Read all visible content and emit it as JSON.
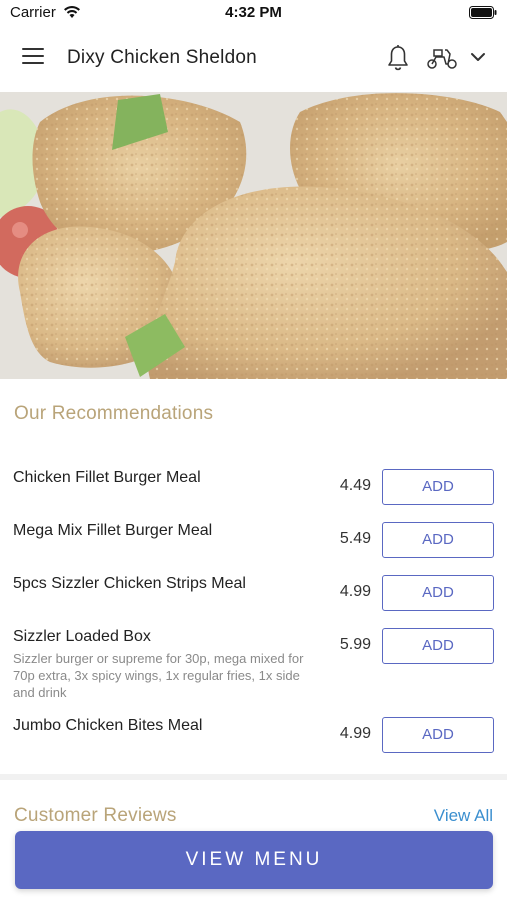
{
  "status_bar": {
    "carrier": "Carrier",
    "time": "4:32 PM",
    "icons": [
      "wifi-icon",
      "battery-icon"
    ]
  },
  "header": {
    "title": "Dixy Chicken Sheldon",
    "icons": [
      "menu-icon",
      "bell-icon",
      "scooter-icon",
      "chevron-down-icon"
    ]
  },
  "hero": {
    "image": "fried-chicken-photo"
  },
  "recommendations": {
    "title": "Our Recommendations",
    "items": [
      {
        "name": "Chicken Fillet Burger Meal",
        "description": "",
        "price": "4.49",
        "button": "ADD"
      },
      {
        "name": "Mega Mix Fillet Burger Meal",
        "description": "",
        "price": "5.49",
        "button": "ADD"
      },
      {
        "name": "5pcs Sizzler Chicken Strips Meal",
        "description": "",
        "price": "4.99",
        "button": "ADD"
      },
      {
        "name": "Sizzler Loaded Box",
        "description": "Sizzler burger or supreme for 30p, mega mixed for 70p extra, 3x spicy wings, 1x regular fries, 1x side and drink",
        "price": "5.99",
        "button": "ADD"
      },
      {
        "name": "Jumbo Chicken Bites Meal",
        "description": "",
        "price": "4.99",
        "button": "ADD"
      }
    ]
  },
  "reviews": {
    "title": "Customer Reviews",
    "view_all": "View All"
  },
  "footer": {
    "view_menu": "VIEW MENU"
  },
  "colors": {
    "accent": "#5a68c2",
    "section_title": "#b9a479",
    "link": "#3b8fcf"
  }
}
